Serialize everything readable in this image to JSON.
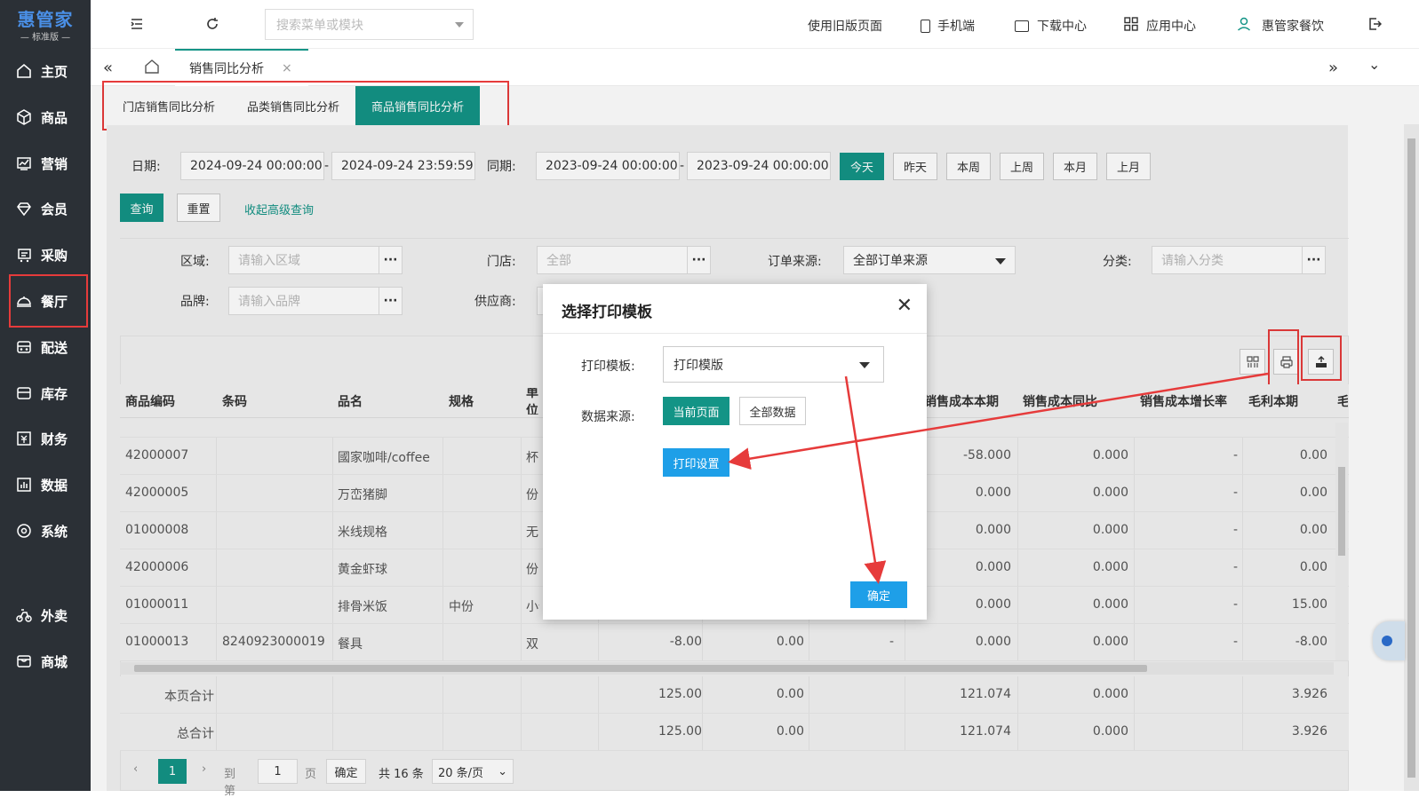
{
  "brand": {
    "name": "惠管家",
    "edition": "— 标准版 —"
  },
  "sidebar": {
    "items": [
      {
        "label": "主页",
        "icon": "home-icon"
      },
      {
        "label": "商品",
        "icon": "box-icon"
      },
      {
        "label": "营销",
        "icon": "chart-icon"
      },
      {
        "label": "会员",
        "icon": "diamond-icon"
      },
      {
        "label": "采购",
        "icon": "cart-icon"
      },
      {
        "label": "餐厅",
        "icon": "cloche-icon"
      },
      {
        "label": "配送",
        "icon": "delivery-icon"
      },
      {
        "label": "库存",
        "icon": "inventory-icon"
      },
      {
        "label": "财务",
        "icon": "finance-icon"
      },
      {
        "label": "数据",
        "icon": "data-icon"
      },
      {
        "label": "系统",
        "icon": "settings-icon"
      },
      {
        "label": "外卖",
        "icon": "bike-icon"
      },
      {
        "label": "商城",
        "icon": "store-icon"
      }
    ]
  },
  "topbar": {
    "search_placeholder": "搜索菜单或模块",
    "old_page": "使用旧版页面",
    "mobile": "手机端",
    "download": "下载中心",
    "apps": "应用中心",
    "user": "惠管家餐饮"
  },
  "tabs": {
    "active": "销售同比分析"
  },
  "subtabs": [
    "门店销售同比分析",
    "品类销售同比分析",
    "商品销售同比分析"
  ],
  "filters": {
    "date_label": "日期:",
    "date_start": "2024-09-24 00:00:00",
    "date_end": "2024-09-24 23:59:59",
    "same_label": "同期:",
    "same_start": "2023-09-24 00:00:00",
    "same_end": "2023-09-24 00:00:00",
    "sep": "-",
    "quick": [
      "今天",
      "昨天",
      "本周",
      "上周",
      "本月",
      "上月"
    ],
    "query": "查询",
    "reset": "重置",
    "collapse": "收起高级查询",
    "region_label": "区域:",
    "region_ph": "请输入区域",
    "store_label": "门店:",
    "store_value": "全部",
    "source_label": "订单来源:",
    "source_value": "全部订单来源",
    "category_label": "分类:",
    "category_ph": "请输入分类",
    "brand_label": "品牌:",
    "brand_ph": "请输入品牌",
    "supplier_label": "供应商:",
    "dots": "···"
  },
  "table": {
    "headers_left": [
      "商品编码",
      "条码",
      "品名",
      "规格",
      "单位"
    ],
    "headers_right": [
      "销售成本本期",
      "销售成本同比",
      "销售成本增长率",
      "毛利本期",
      "毛"
    ],
    "rows": [
      {
        "code": "42000007",
        "barcode": "",
        "name": "國家咖啡/coffee",
        "spec": "",
        "unit": "杯",
        "a": "",
        "b": "",
        "c": "",
        "cost": "-58.000",
        "cost_yoy": "0.000",
        "rate": "-",
        "profit": "0.00"
      },
      {
        "code": "42000005",
        "barcode": "",
        "name": "万峦猪脚",
        "spec": "",
        "unit": "份",
        "a": "",
        "b": "",
        "c": "",
        "cost": "0.000",
        "cost_yoy": "0.000",
        "rate": "-",
        "profit": "0.00"
      },
      {
        "code": "01000008",
        "barcode": "",
        "name": "米线规格",
        "spec": "",
        "unit": "无",
        "a": "",
        "b": "",
        "c": "",
        "cost": "0.000",
        "cost_yoy": "0.000",
        "rate": "-",
        "profit": "0.00"
      },
      {
        "code": "42000006",
        "barcode": "",
        "name": "黄金虾球",
        "spec": "",
        "unit": "份",
        "a": "",
        "b": "",
        "c": "",
        "cost": "0.000",
        "cost_yoy": "0.000",
        "rate": "-",
        "profit": "0.00"
      },
      {
        "code": "01000011",
        "barcode": "",
        "name": "排骨米饭",
        "spec": "中份",
        "unit": "小份",
        "a": "",
        "b": "",
        "c": "",
        "cost": "0.000",
        "cost_yoy": "0.000",
        "rate": "-",
        "profit": "15.00"
      },
      {
        "code": "01000013",
        "barcode": "8240923000019",
        "name": "餐具",
        "spec": "",
        "unit": "双",
        "a": "-8.00",
        "b": "0.00",
        "c": "-",
        "cost": "0.000",
        "cost_yoy": "0.000",
        "rate": "-",
        "profit": "-8.00"
      }
    ],
    "totals": [
      {
        "label": "本页合计",
        "a": "125.00",
        "b": "0.00",
        "cost": "121.074",
        "cost_yoy": "0.000",
        "profit": "3.926"
      },
      {
        "label": "总合计",
        "a": "125.00",
        "b": "0.00",
        "cost": "121.074",
        "cost_yoy": "0.000",
        "profit": "3.926"
      }
    ]
  },
  "pagination": {
    "page": "1",
    "goto": "到第",
    "page_input": "1",
    "page_unit": "页",
    "confirm": "确定",
    "total": "共 16 条",
    "per_page": "20 条/页"
  },
  "modal": {
    "title": "选择打印模板",
    "template_label": "打印模板:",
    "template_value": "打印模版",
    "source_label": "数据来源:",
    "current_page": "当前页面",
    "all_data": "全部数据",
    "print_settings": "打印设置",
    "ok": "确定"
  }
}
